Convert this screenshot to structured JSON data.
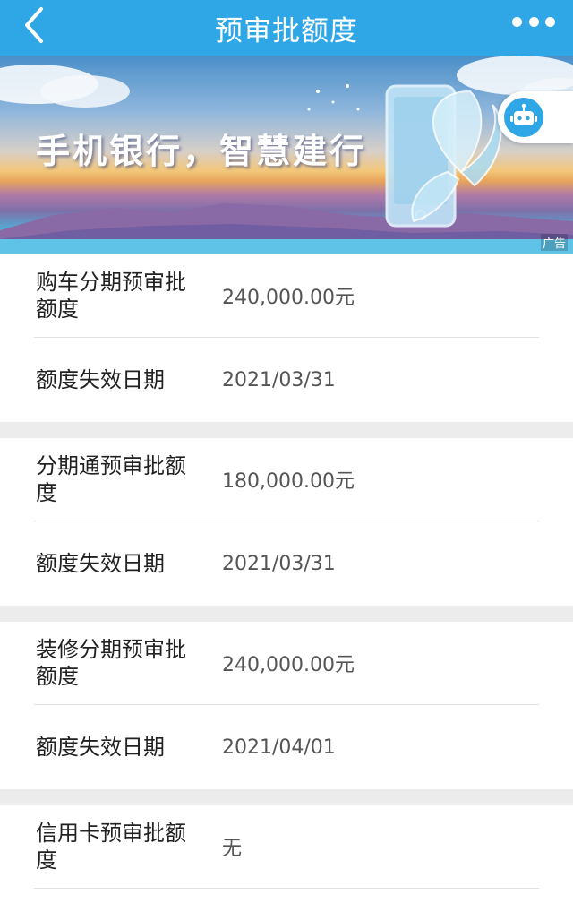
{
  "header": {
    "title": "预审批额度"
  },
  "banner": {
    "slogan": "手机银行，智慧建行",
    "ad_label": "广告"
  },
  "sections": [
    {
      "quota_label": "购车分期预审批额度",
      "quota_value": "240,000.00元",
      "expiry_label": "额度失效日期",
      "expiry_value": "2021/03/31"
    },
    {
      "quota_label": "分期通预审批额度",
      "quota_value": "180,000.00元",
      "expiry_label": "额度失效日期",
      "expiry_value": "2021/03/31"
    },
    {
      "quota_label": "装修分期预审批额度",
      "quota_value": "240,000.00元",
      "expiry_label": "额度失效日期",
      "expiry_value": "2021/04/01"
    },
    {
      "quota_label": "信用卡预审批额度",
      "quota_value": "无"
    }
  ],
  "colors": {
    "nav_bg": "#2fa7e6",
    "divider": "#e1e1e1",
    "value_text": "#555555"
  },
  "icons": {
    "back": "chevron-left-icon",
    "more": "more-dots-icon",
    "assistant": "robot-icon"
  }
}
